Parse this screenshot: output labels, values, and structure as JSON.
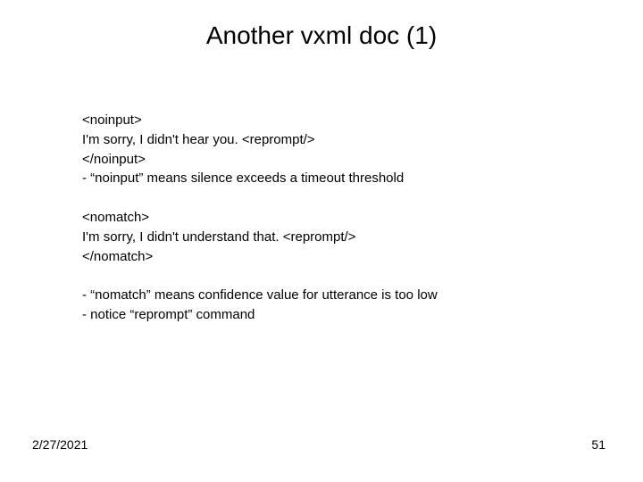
{
  "title": "Another vxml doc (1)",
  "block1": {
    "l1": "<noinput>",
    "l2": "I'm sorry, I didn't hear you.  <reprompt/>",
    "l3": "</noinput>",
    "l4": "- “noinput” means silence exceeds a timeout threshold"
  },
  "block2": {
    "l1": "<nomatch>",
    "l2": "I'm sorry, I didn't understand that.  <reprompt/>",
    "l3": "</nomatch>"
  },
  "block3": {
    "l1": "- “nomatch” means confidence value for utterance is too low",
    "l2": "-  notice “reprompt” command"
  },
  "footer": {
    "date": "2/27/2021",
    "page": "51"
  }
}
